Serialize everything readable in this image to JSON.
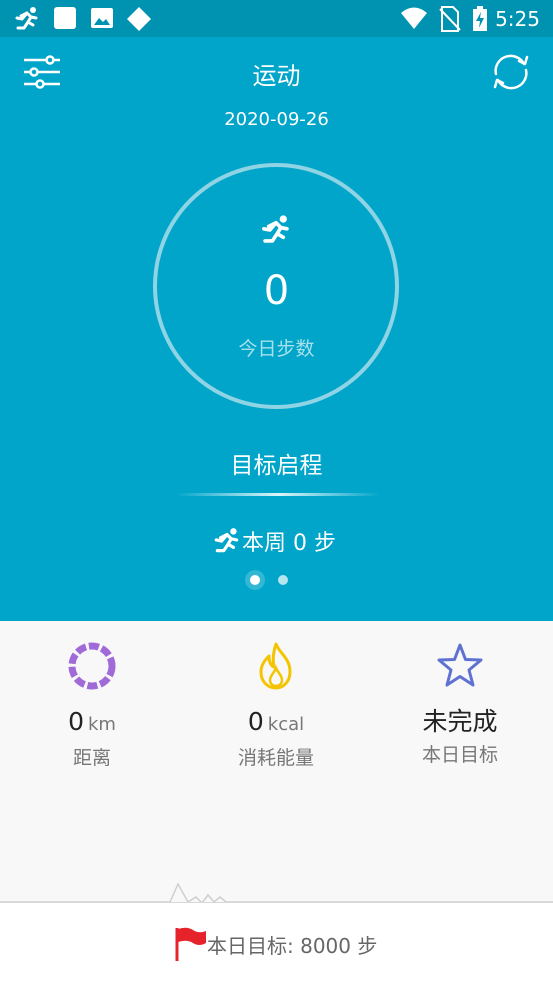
{
  "status_bar": {
    "time": "5:25",
    "icons": [
      "running-icon",
      "square-icon",
      "image-icon",
      "diamond-icon",
      "wifi-icon",
      "no-sim-icon",
      "battery-charging-icon"
    ]
  },
  "header": {
    "title": "运动",
    "date": "2020-09-26",
    "left_icon": "settings-sliders-icon",
    "right_icon": "sync-icon"
  },
  "today": {
    "steps": "0",
    "steps_label": "今日步数",
    "icon": "running-icon"
  },
  "goal": {
    "label": "目标启程"
  },
  "week": {
    "text": "本周 0 步",
    "icon": "running-icon"
  },
  "pager": {
    "count": 2,
    "active": 0
  },
  "stats": [
    {
      "icon": "ring-icon",
      "value": "0",
      "unit": "km",
      "label": "距离",
      "color": "#a06bd8"
    },
    {
      "icon": "flame-icon",
      "value": "0",
      "unit": "kcal",
      "label": "消耗能量",
      "color": "#f5c400"
    },
    {
      "icon": "star-icon",
      "value": "未完成",
      "unit": "",
      "label": "本日目标",
      "color": "#5f72d2"
    }
  ],
  "bottom": {
    "goal_text": "本日目标: 8000 步",
    "icon": "flag-icon",
    "flag_color": "#e6232b"
  },
  "colors": {
    "primary": "#00a5c9",
    "status_bar": "#0093b1"
  }
}
